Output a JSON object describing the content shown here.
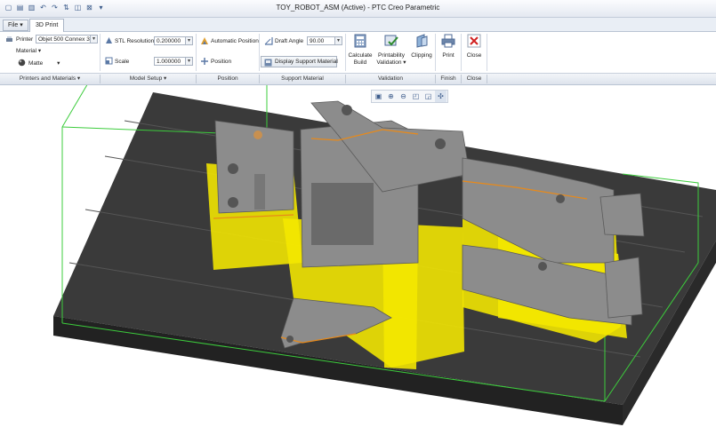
{
  "window": {
    "title": "TOY_ROBOT_ASM (Active) - PTC Creo Parametric"
  },
  "quick_access": [
    "new-icon",
    "open-icon",
    "save-icon",
    "undo-icon",
    "redo-icon",
    "regenerate-icon",
    "windows-icon",
    "close-window-icon",
    "customize-icon"
  ],
  "tabs": {
    "file": "File",
    "active": "3D Print"
  },
  "printers": {
    "printer_label": "Printer",
    "printer_value": "Objet 500 Connex 3",
    "material_label": "Material",
    "finish_value": "Matte",
    "group_label": "Printers and Materials"
  },
  "model_setup": {
    "stl_label": "STL Resolution",
    "stl_value": "0.200000",
    "scale_label": "Scale",
    "scale_value": "1.000000",
    "group_label": "Model Setup"
  },
  "position": {
    "auto_label": "Automatic Position",
    "position_label": "Position",
    "group_label": "Position"
  },
  "support": {
    "draft_label": "Draft Angle",
    "draft_value": "90.00",
    "display_label": "Display Support Material",
    "group_label": "Support Material"
  },
  "validation": {
    "calc_line1": "Calculate",
    "calc_line2": "Build",
    "print_line1": "Printability",
    "print_line2": "Validation",
    "clip_label": "Clipping",
    "group_label": "Validation"
  },
  "finish": {
    "print_label": "Print",
    "group_label": "Finish"
  },
  "close": {
    "close_label": "Close",
    "group_label": "Close"
  },
  "view_toolbar": [
    "refit-icon",
    "zoom-in-icon",
    "zoom-out-icon",
    "repaint-icon",
    "view-manager-icon",
    "spin-center-icon"
  ],
  "colors": {
    "support": "#f5e800",
    "model": "#8c8c8c",
    "tray": "#3a3a3a",
    "bbox": "#3ccc3c",
    "accent": "#3a5a8a"
  }
}
